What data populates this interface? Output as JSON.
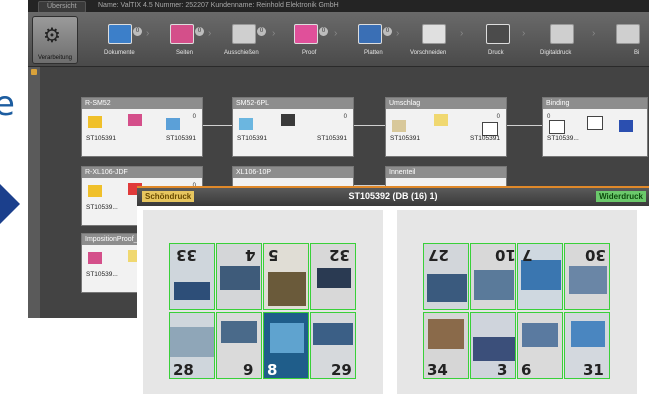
{
  "left": {
    "letter": "e"
  },
  "titlebar": {
    "button_label": "Übersicht",
    "text": "Name: ValTIX 4.5   Nummer: 252207   Kundenname: Reinhold Elektronik GmbH"
  },
  "toolbar": {
    "processing_label": "Verarbeitung",
    "steps": [
      {
        "label": "Dokumente",
        "count": "0",
        "color": "#3c7fc9"
      },
      {
        "label": "Seiten",
        "count": "0",
        "color": "#d44f8a"
      },
      {
        "label": "Ausschießen",
        "count": "0",
        "color": "#cfcfcf"
      },
      {
        "label": "Proof",
        "count": "0",
        "color": "#e0509a"
      },
      {
        "label": "Platten",
        "count": "0",
        "color": "#3a6fb5"
      },
      {
        "label": "Vorschneiden",
        "count": "",
        "color": "#e0e0e0"
      },
      {
        "label": "Druck",
        "count": "",
        "color": "#4b4b4b"
      },
      {
        "label": "Digitaldruck",
        "count": "",
        "color": "#cfcfcf"
      },
      {
        "label": "Bi",
        "count": "",
        "color": "#cfcfcf"
      }
    ]
  },
  "nodes": [
    {
      "id": "n1",
      "title": "R-SM52",
      "code": "ST105391",
      "code2": "ST105391",
      "zero": "0"
    },
    {
      "id": "n2",
      "title": "SM52-6PL",
      "code": "ST105391",
      "code2": "ST105391",
      "zero": "0"
    },
    {
      "id": "n3",
      "title": "Umschlag",
      "code": "ST105391",
      "code2": "ST105391",
      "zero": "0"
    },
    {
      "id": "n4",
      "title": "Binding",
      "code": "ST10539...",
      "code2": "",
      "zero": "0"
    },
    {
      "id": "n5",
      "title": "R-XL106-JDF",
      "code": "ST10539...",
      "code2": "",
      "zero": "0"
    },
    {
      "id": "n6",
      "title": "XL106-10P",
      "code": "",
      "code2": "",
      "zero": ""
    },
    {
      "id": "n7",
      "title": "Innenteil",
      "code": "",
      "code2": "",
      "zero": ""
    },
    {
      "id": "n8",
      "title": "ImpositionProof_f...",
      "code": "ST10539...",
      "code2": "",
      "zero": ""
    }
  ],
  "preview": {
    "front_label": "Schöndruck",
    "title": "ST105392 (DB (16) 1)",
    "back_label": "Widerdruck",
    "front_pages_top": [
      "33",
      "4",
      "5",
      "32"
    ],
    "front_pages_bottom": [
      "28",
      "9",
      "8",
      "29"
    ],
    "back_pages_top": [
      "27",
      "10",
      "7",
      "30"
    ],
    "back_pages_bottom": [
      "34",
      "3",
      "6",
      "31"
    ]
  },
  "colors": {
    "accent_orange": "#e0892a",
    "front_tag": "#e7c65f",
    "back_tag": "#6bc96b",
    "page_border": "#39d039",
    "arrow": "#1b3f8c"
  }
}
